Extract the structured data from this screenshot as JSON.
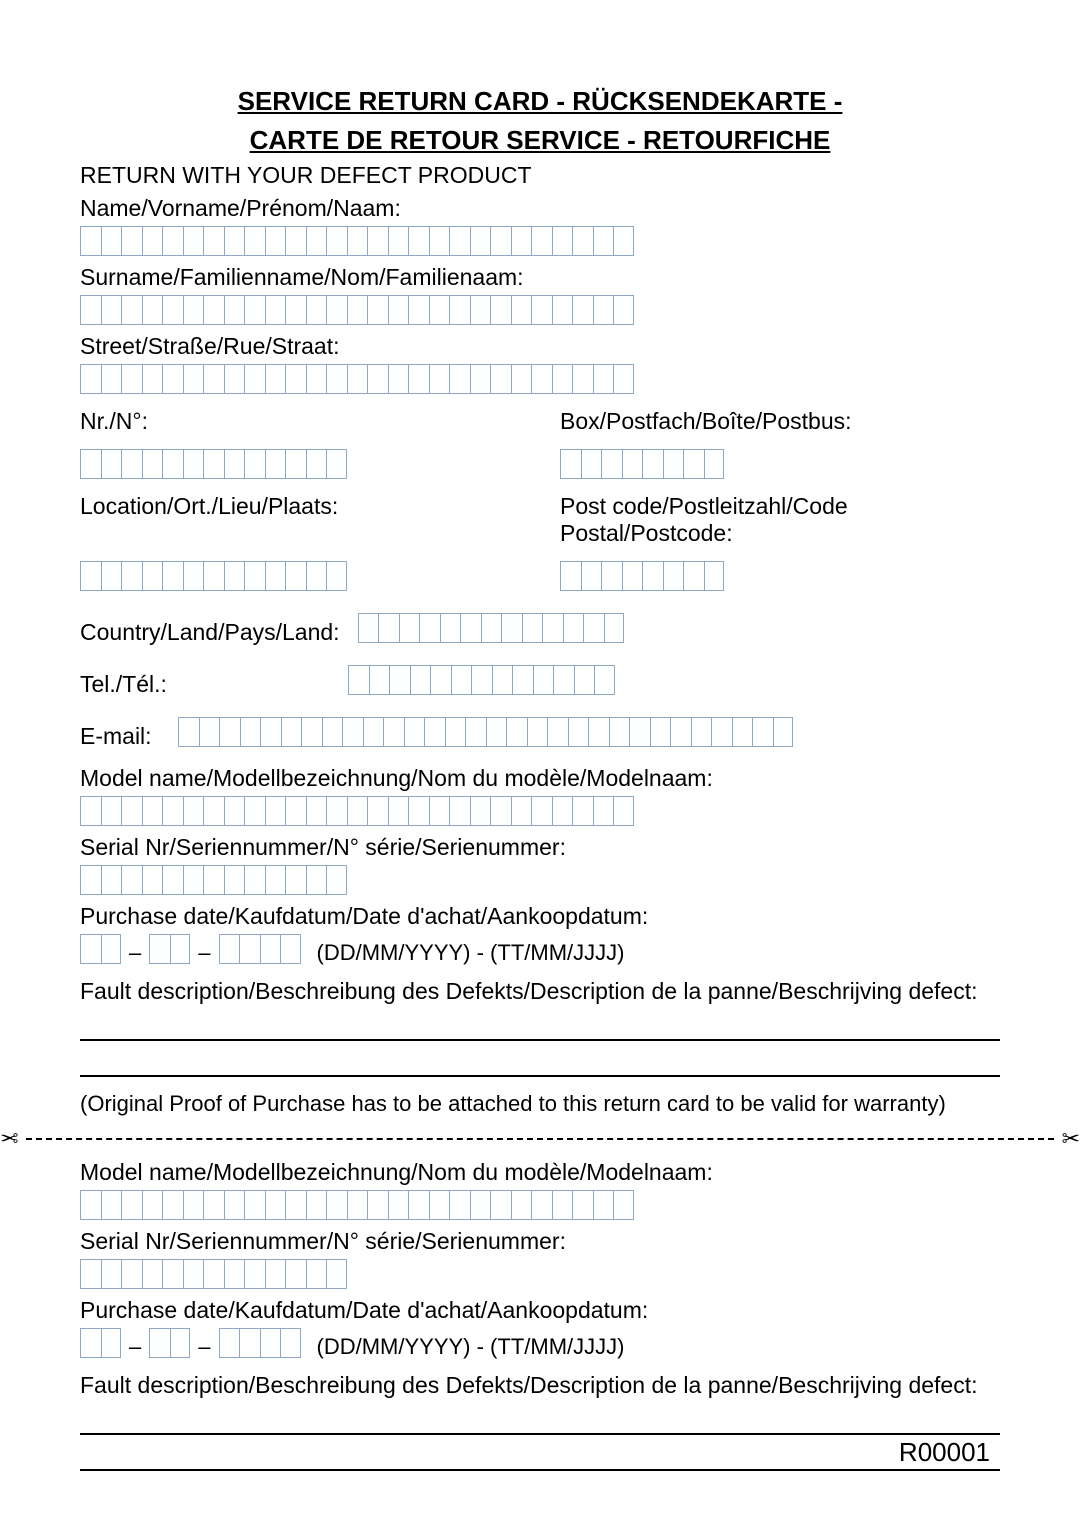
{
  "title_line1": "SERVICE RETURN CARD - RÜCKSENDEKARTE -",
  "title_line2": "CARTE DE RETOUR SERVICE - RETOURFICHE",
  "return_with": "RETURN WITH YOUR DEFECT PRODUCT",
  "labels": {
    "name": "Name/Vorname/Prénom/Naam:",
    "surname": "Surname/Familienname/Nom/Familienaam:",
    "street": "Street/Straße/Rue/Straat:",
    "nr": "Nr./N°:",
    "box": "Box/Postfach/Boîte/Postbus:",
    "location": "Location/Ort./Lieu/Plaats:",
    "postcode": "Post code/Postleitzahl/Code Postal/Postcode:",
    "country": "Country/Land/Pays/Land:",
    "tel": "Tel./Tél.:",
    "email": "E-mail:",
    "model": "Model name/Modellbezeichnung/Nom du modèle/Modelnaam:",
    "serial": "Serial Nr/Seriennummer/N° série/Serienummer:",
    "purchase": "Purchase date/Kaufdatum/Date d'achat/Aankoopdatum:",
    "date_hint": "(DD/MM/YYYY) - (TT/MM/JJJJ)",
    "fault": "Fault description/Beschreibung des Defekts/Description de la panne/Beschrijving defect:",
    "proof": "(Original Proof of Purchase has to be attached to this return card to be valid for warranty)"
  },
  "box_counts": {
    "name": 27,
    "surname": 27,
    "street": 27,
    "nr": 13,
    "box": 8,
    "location": 13,
    "postcode": 8,
    "country": 13,
    "tel": 13,
    "email": 30,
    "model": 27,
    "serial": 13,
    "date_dd": 2,
    "date_mm": 2,
    "date_yyyy": 4
  },
  "footer": "R00001",
  "scissor_glyph": "✂"
}
